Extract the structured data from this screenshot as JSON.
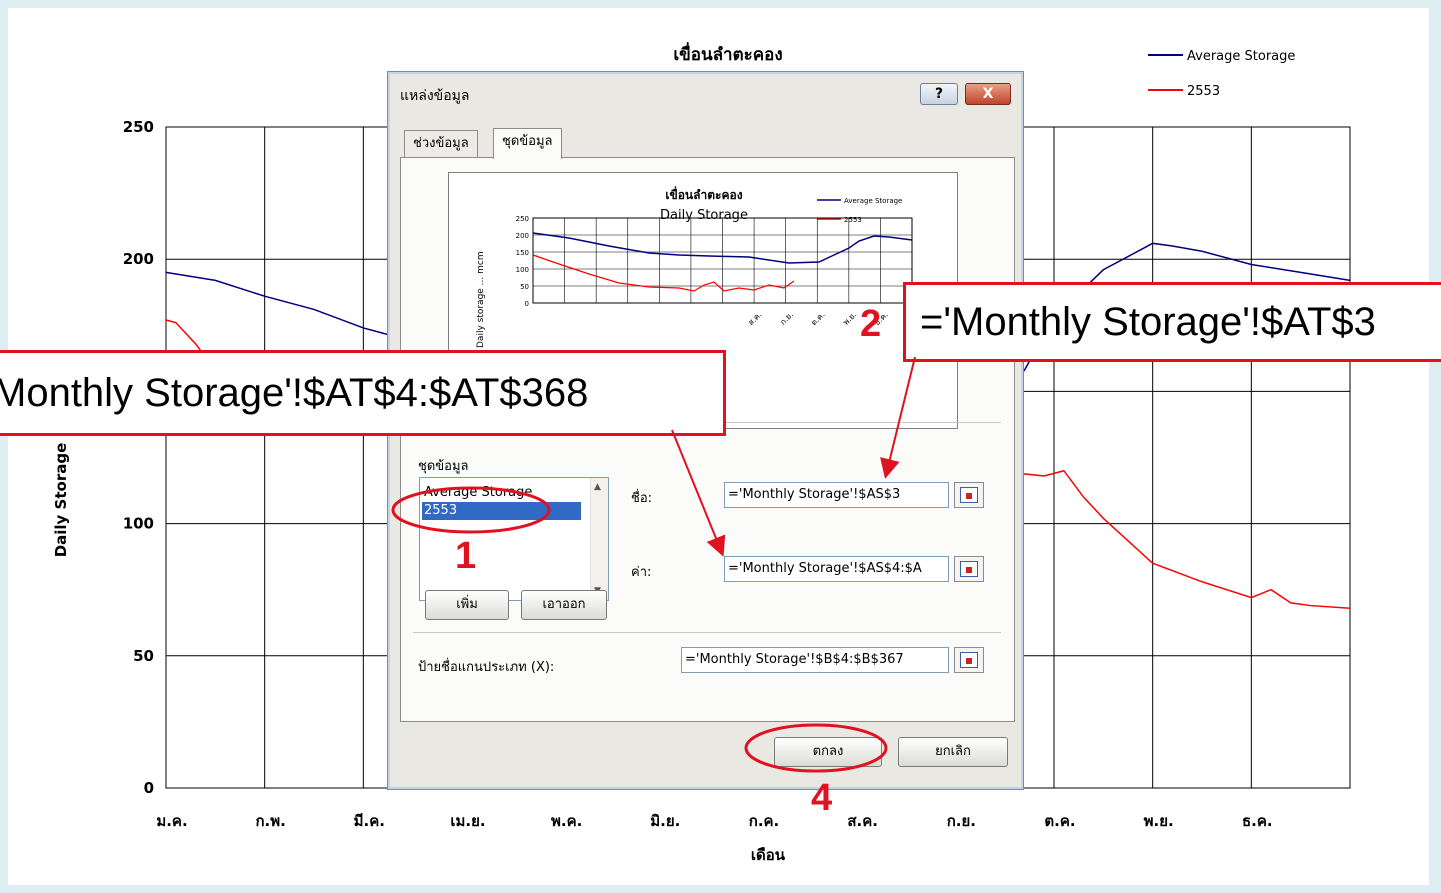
{
  "chart_data": {
    "type": "line",
    "title": "เขื่อนลำตะคอง",
    "xlabel": "เดือน",
    "ylabel": "Daily Storage",
    "ylim": [
      0,
      250
    ],
    "y_ticks": [
      "0",
      "50",
      "100",
      "150",
      "200",
      "250"
    ],
    "categories": [
      "ม.ค.",
      "ก.พ.",
      "มี.ค.",
      "เม.ย.",
      "พ.ค.",
      "มิ.ย.",
      "ก.ค.",
      "ส.ค.",
      "ก.ย.",
      "ต.ค.",
      "พ.ย.",
      "ธ.ค."
    ],
    "grid": true,
    "legend": "top-right",
    "series": [
      {
        "name": "Average Storage",
        "color": "#00007f",
        "x": [
          0,
          0.5,
          1.0,
          1.5,
          2.0,
          2.4,
          8.3,
          8.7,
          9.0,
          9.5,
          10.0,
          10.2,
          10.5,
          11.0,
          11.5,
          12.0
        ],
        "values": [
          195,
          192,
          186,
          181,
          174,
          170,
          145,
          158,
          178,
          196,
          206,
          205,
          203,
          198,
          195,
          192
        ]
      },
      {
        "name": "2553",
        "color": "#ff0000",
        "x": [
          0,
          0.1,
          0.3,
          0.5,
          0.7,
          8.9,
          9.1,
          9.3,
          9.5,
          10.0,
          10.5,
          11.0,
          11.2,
          11.4,
          11.6,
          12.0
        ],
        "values": [
          177,
          176,
          168,
          158,
          150,
          118,
          120,
          110,
          102,
          85,
          78,
          72,
          75,
          70,
          69,
          68
        ]
      }
    ]
  },
  "dialog": {
    "title": "แหล่งข้อมูล",
    "help_label": "?",
    "close_label": "X",
    "tabs": [
      "ช่วงข้อมูล",
      "ชุดข้อมูล"
    ],
    "preview": {
      "title": "เขื่อนลำตะคอง",
      "subtitle": "Daily Storage",
      "ylabel": "Daily storage ... mcm",
      "y_ticks": [
        "250",
        "200",
        "150",
        "100",
        "50",
        "0"
      ],
      "x_ticks": [
        "ส.ค.",
        "ก.ย.",
        "ต.ค.",
        "พ.ย.",
        "ธ.ค."
      ],
      "legend": [
        "Average Storage",
        "2553"
      ]
    },
    "series_group_label": "ชุดข้อมูล",
    "series_list": [
      "Average Storage",
      "2553"
    ],
    "name_label": "ชื่อ:",
    "name_value": "='Monthly Storage'!$AS$3",
    "values_label": "ค่า:",
    "values_value": "='Monthly Storage'!$AS$4:$A",
    "add_button": "เพิ่ม",
    "remove_button": "เอาออก",
    "category_label": "ป้ายชื่อแกนประเภท (X):",
    "category_value": "='Monthly Storage'!$B$4:$B$367",
    "ok_button": "ตกลง",
    "cancel_button": "ยกเลิก"
  },
  "annotations": {
    "callout_values": "Monthly Storage'!$AT$4:$AT$368",
    "callout_name": "='Monthly Storage'!$AT$3",
    "step_1": "1",
    "step_2": "2",
    "step_4": "4",
    "color": "#e0121f"
  }
}
